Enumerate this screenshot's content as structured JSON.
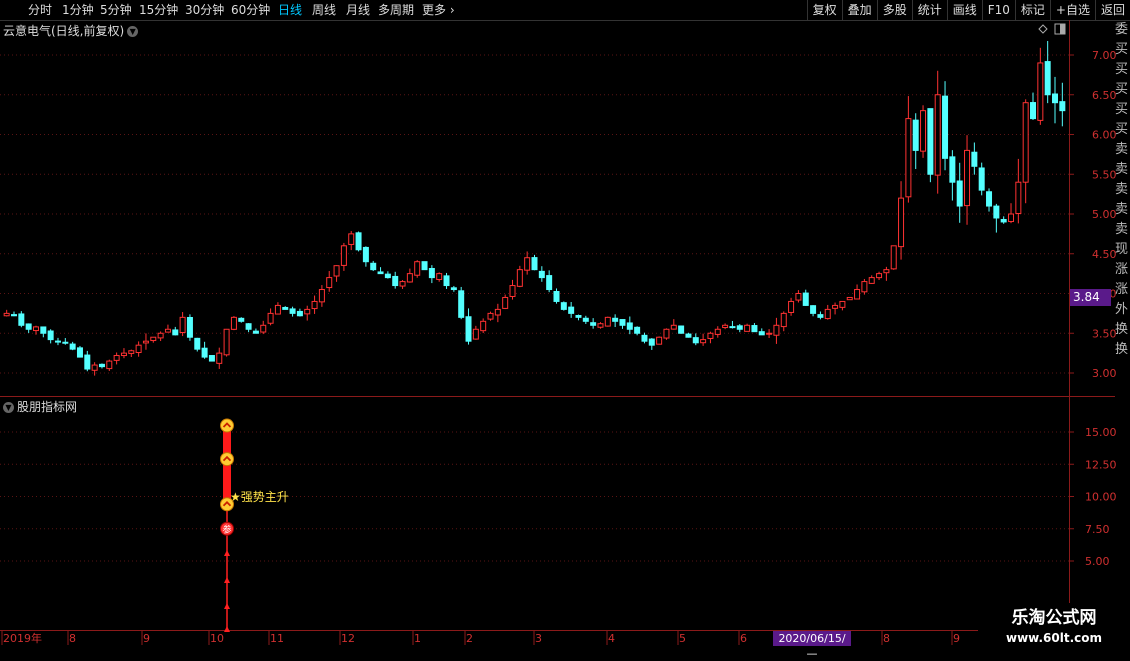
{
  "toolbar": {
    "periods": [
      "分时",
      "1分钟",
      "5分钟",
      "15分钟",
      "30分钟",
      "60分钟",
      "日线",
      "周线",
      "月线",
      "多周期",
      "更多"
    ],
    "active_period": "日线",
    "tools": [
      "复权",
      "叠加",
      "多股",
      "统计",
      "画线",
      "F10",
      "标记",
      "+自选",
      "返回"
    ]
  },
  "main_panel": {
    "title": "云意电气(日线,前复权)",
    "price_tag": "3.84",
    "y_ticks": [
      "7.00",
      "6.50",
      "6.00",
      "5.50",
      "5.00",
      "4.50",
      "4.00",
      "3.50",
      "3.00"
    ]
  },
  "indicator_panel": {
    "title": "股朋指标网",
    "y_ticks": [
      "15.00",
      "12.50",
      "10.00",
      "7.50",
      "5.00"
    ],
    "signal_label": "★强势主升",
    "marker_glyph": "参"
  },
  "x_axis": {
    "labels": [
      "2019年",
      "8",
      "9",
      "10",
      "11",
      "12",
      "1",
      "2",
      "3",
      "4",
      "5",
      "6",
      "8",
      "9"
    ],
    "date_tag": "2020/06/15/—"
  },
  "watermark": {
    "line1": "乐淘公式网",
    "line2": "www.60lt.com"
  },
  "right_strip_glyphs": [
    "委",
    "买",
    "买",
    "买",
    "买",
    "买",
    "卖",
    "卖",
    "卖",
    "卖",
    "卖",
    "现",
    "涨",
    "涨",
    "外",
    "换",
    "换"
  ],
  "chart_data": {
    "type": "candlestick",
    "title": "云意电气(日线,前复权)",
    "ylim": [
      2.9,
      7.2
    ],
    "last_price": 3.84,
    "approx_daily_closes": [
      3.75,
      3.72,
      3.6,
      3.55,
      3.58,
      3.5,
      3.42,
      3.4,
      3.38,
      3.3,
      3.2,
      3.05,
      3.1,
      3.08,
      3.15,
      3.22,
      3.25,
      3.28,
      3.35,
      3.4,
      3.45,
      3.5,
      3.55,
      3.48,
      3.7,
      3.45,
      3.3,
      3.2,
      3.15,
      3.25,
      3.55,
      3.7,
      3.65,
      3.55,
      3.5,
      3.6,
      3.75,
      3.85,
      3.8,
      3.75,
      3.72,
      3.8,
      3.9,
      4.05,
      4.2,
      4.35,
      4.6,
      4.75,
      4.55,
      4.4,
      4.3,
      4.25,
      4.2,
      4.1,
      4.15,
      4.25,
      4.4,
      4.3,
      4.2,
      4.25,
      4.1,
      4.05,
      3.7,
      3.4,
      3.55,
      3.65,
      3.75,
      3.8,
      3.95,
      4.1,
      4.3,
      4.45,
      4.3,
      4.2,
      4.05,
      3.9,
      3.8,
      3.75,
      3.7,
      3.65,
      3.6,
      3.62,
      3.7,
      3.65,
      3.6,
      3.55,
      3.5,
      3.4,
      3.35,
      3.45,
      3.55,
      3.6,
      3.5,
      3.45,
      3.38,
      3.42,
      3.5,
      3.55,
      3.6,
      3.58,
      3.55,
      3.6,
      3.52,
      3.48,
      3.5,
      3.6,
      3.75,
      3.9,
      4.0,
      3.85,
      3.75,
      3.7,
      3.8,
      3.85,
      3.9,
      3.95,
      4.05,
      4.15,
      4.2,
      4.25,
      4.3,
      4.6,
      5.2,
      6.2,
      5.8,
      6.3,
      5.5,
      6.5,
      5.7,
      5.4,
      5.1,
      5.8,
      5.6,
      5.3,
      5.1,
      4.95,
      4.9,
      5.0,
      5.4,
      6.4,
      6.2,
      6.9,
      6.5,
      6.4,
      6.3
    ]
  }
}
